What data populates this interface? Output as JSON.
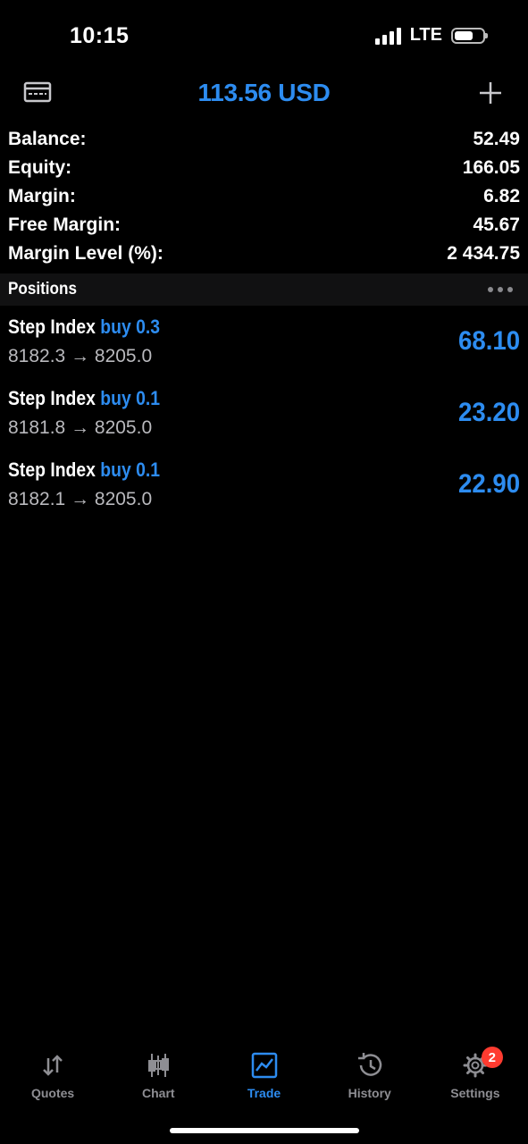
{
  "status_bar": {
    "time": "10:15",
    "network": "LTE",
    "battery_level": 0.65
  },
  "header": {
    "title": "113.56 USD",
    "left_icon": "account-card-icon",
    "right_icon": "plus-icon"
  },
  "summary": [
    {
      "label": "Balance:",
      "value": "52.49"
    },
    {
      "label": "Equity:",
      "value": "166.05"
    },
    {
      "label": "Margin:",
      "value": "6.82"
    },
    {
      "label": "Free Margin:",
      "value": "45.67"
    },
    {
      "label": "Margin Level (%):",
      "value": "2 434.75"
    }
  ],
  "positions": {
    "title": "Positions",
    "items": [
      {
        "symbol": "Step Index",
        "side": "buy 0.3",
        "prices": "8182.3 → 8205.0",
        "profit": "68.10"
      },
      {
        "symbol": "Step Index",
        "side": "buy 0.1",
        "prices": "8181.8 → 8205.0",
        "profit": "23.20"
      },
      {
        "symbol": "Step Index",
        "side": "buy 0.1",
        "prices": "8182.1 → 8205.0",
        "profit": "22.90"
      }
    ]
  },
  "tabs": [
    {
      "label": "Quotes",
      "icon": "quotes-arrows-icon"
    },
    {
      "label": "Chart",
      "icon": "candlestick-icon"
    },
    {
      "label": "Trade",
      "icon": "trade-chart-icon",
      "active": true
    },
    {
      "label": "History",
      "icon": "history-clock-icon"
    },
    {
      "label": "Settings",
      "icon": "gear-icon",
      "badge": "2"
    }
  ],
  "colors": {
    "accent": "#2d8cf0",
    "background": "#000000",
    "badge": "#ff3b30",
    "muted": "#8e8e93"
  }
}
